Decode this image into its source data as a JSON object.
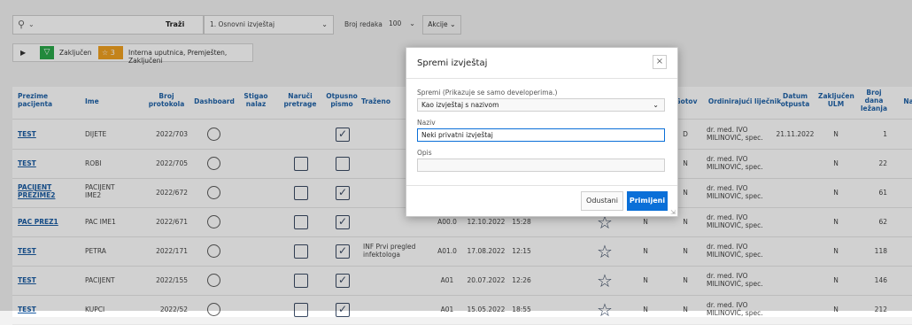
{
  "toolbar": {
    "search_btn": "Traži",
    "report_select": "1. Osnovni izvještaj",
    "rows_label": "Broj redaka",
    "rows_value": "100",
    "actions": "Akcije"
  },
  "filters": {
    "f1": "Zaključen",
    "badge": "3",
    "f2": "Interna uputnica, Premješten, Zaključeni"
  },
  "columns": {
    "prezime": "Prezime pacijenta",
    "ime": "Ime",
    "broj": "Broj protokola",
    "dashboard": "Dashboard",
    "stigao": "Stigao nalaz",
    "naruci": "Naruči pretrage",
    "otpusno": "Otpusno pismo",
    "trazeno": "Traženo",
    "gotov": "Gotov",
    "lijecnik": "Ordinirajući liječnik",
    "datum": "Datum otpusta",
    "zakljucen": "Zaključen ULM",
    "dana": "Broj dana ležanja",
    "na": "Na"
  },
  "rows": [
    {
      "prezime": "TEST",
      "ime": "DIJETE",
      "broj": "2022/703",
      "trazeno": "",
      "dg": "",
      "datum": "",
      "vrijeme": "",
      "n1": "",
      "gotov": "D",
      "lijecnik": "dr. med. IVO MILINOVIĆ, spec.",
      "otpust": "21.11.2022",
      "zakljucen": "N",
      "dana": "1",
      "has_list": false,
      "checked": true
    },
    {
      "prezime": "TEST",
      "ime": "ROBI",
      "broj": "2022/705",
      "trazeno": "",
      "dg": "",
      "datum": "",
      "vrijeme": "",
      "n1": "",
      "gotov": "N",
      "lijecnik": "dr. med. IVO MILINOVIĆ, spec.",
      "otpust": "",
      "zakljucen": "N",
      "dana": "22",
      "has_list": true,
      "checked": false
    },
    {
      "prezime": "PACIJENT PREZIME2",
      "ime": "PACIJENT IME2",
      "broj": "2022/672",
      "trazeno": "",
      "dg": "",
      "datum": "",
      "vrijeme": "",
      "n1": "",
      "gotov": "N",
      "lijecnik": "dr. med. IVO MILINOVIĆ, spec.",
      "otpust": "",
      "zakljucen": "N",
      "dana": "61",
      "has_list": true,
      "checked": true
    },
    {
      "prezime": "PAC PREZ1",
      "ime": "PAC IME1",
      "broj": "2022/671",
      "trazeno": "",
      "dg": "A00.0",
      "datum": "12.10.2022",
      "vrijeme": "15:28",
      "n1": "N",
      "gotov": "N",
      "lijecnik": "dr. med. IVO MILINOVIĆ, spec.",
      "otpust": "",
      "zakljucen": "N",
      "dana": "62",
      "has_list": true,
      "checked": true
    },
    {
      "prezime": "TEST",
      "ime": "PETRA",
      "broj": "2022/171",
      "trazeno": "INF Prvi pregled infektologa",
      "dg": "A01.0",
      "datum": "17.08.2022",
      "vrijeme": "12:15",
      "n1": "N",
      "gotov": "N",
      "lijecnik": "dr. med. IVO MILINOVIĆ, spec.",
      "otpust": "",
      "zakljucen": "N",
      "dana": "118",
      "has_list": true,
      "checked": true
    },
    {
      "prezime": "TEST",
      "ime": "PACIJENT",
      "broj": "2022/155",
      "trazeno": "",
      "dg": "A01",
      "datum": "20.07.2022",
      "vrijeme": "12:26",
      "n1": "N",
      "gotov": "N",
      "lijecnik": "dr. med. IVO MILINOVIĆ, spec.",
      "otpust": "",
      "zakljucen": "N",
      "dana": "146",
      "has_list": true,
      "checked": true
    },
    {
      "prezime": "TEST",
      "ime": "KUPCI",
      "broj": "2022/52",
      "trazeno": "",
      "dg": "A01",
      "datum": "15.05.2022",
      "vrijeme": "18:55",
      "n1": "N",
      "gotov": "N",
      "lijecnik": "dr. med. IVO MILINOVIĆ, spec.",
      "otpust": "",
      "zakljucen": "N",
      "dana": "212",
      "has_list": true,
      "checked": true
    }
  ],
  "modal": {
    "title": "Spremi izvještaj",
    "close": "×",
    "save_label": "Spremi (Prikazuje se samo developerima.)",
    "save_value": "Kao izvještaj s nazivom",
    "name_label": "Naziv",
    "name_value": "Neki privatni izvještaj",
    "desc_label": "Opis",
    "desc_value": "",
    "cancel": "Odustani",
    "apply": "Primijeni"
  },
  "colors": {
    "accent": "#0a6fd8",
    "filter_green": "#2aa84a",
    "badge_orange": "#f0a020",
    "link": "#1a5ca3"
  }
}
